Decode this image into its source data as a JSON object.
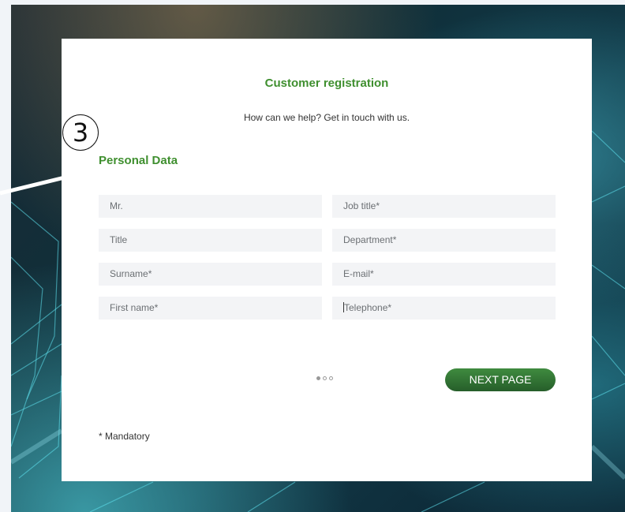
{
  "form": {
    "title": "Customer registration",
    "subtitle": "How can we help? Get in touch with us."
  },
  "section": {
    "title": "Personal Data"
  },
  "fields": {
    "salutation": "Mr.",
    "title": "Title",
    "surname": "Surname*",
    "first_name": "First name*",
    "job_title": "Job title*",
    "department": "Department*",
    "email": "E-mail*",
    "telephone": "Telephone*"
  },
  "pagination": {
    "total": 3,
    "current": 1
  },
  "buttons": {
    "next": "NEXT PAGE"
  },
  "footer": {
    "mandatory_note": "* Mandatory"
  },
  "annotation": {
    "step_marker": "3"
  },
  "colors": {
    "accent_green": "#3f8f2f",
    "button_green": "#2f6f33",
    "field_bg": "#f3f4f6"
  }
}
